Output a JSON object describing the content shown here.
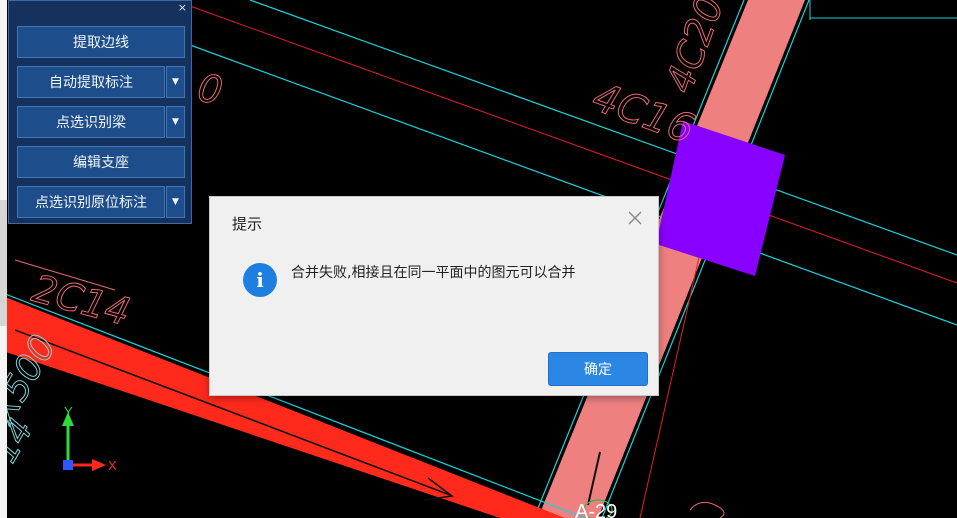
{
  "toolbar": {
    "buttons": [
      {
        "label": "提取边线",
        "has_dropdown": false
      },
      {
        "label": "自动提取标注",
        "has_dropdown": true
      },
      {
        "label": "点选识别梁",
        "has_dropdown": true
      },
      {
        "label": "编辑支座",
        "has_dropdown": false
      },
      {
        "label": "点选识别原位标注",
        "has_dropdown": true
      }
    ],
    "close_glyph": "×",
    "dropdown_glyph": "▼"
  },
  "dialog": {
    "title": "提示",
    "message": "合并失败,相接且在同一平面中的图元可以合并",
    "ok_label": "确定",
    "icon": "info-icon"
  },
  "drawing": {
    "annotations": {
      "beam_rebar_1": "4C16",
      "beam_rebar_2": "4C20",
      "beam_rebar_3": "2C14",
      "section_partial": "0",
      "section_partial_2": "X500",
      "rebar_partial": "14",
      "axis_label": "A-29"
    },
    "ucs": {
      "x_label": "X",
      "y_label": "Y"
    },
    "colors": {
      "background": "#000000",
      "cyan_line": "#19d3d9",
      "red_line": "#e31e24",
      "beam_red": "#ff2a1c",
      "beam_pink": "#ee8080",
      "column_purple": "#8800ff",
      "annotation": "#e66a6a"
    }
  }
}
